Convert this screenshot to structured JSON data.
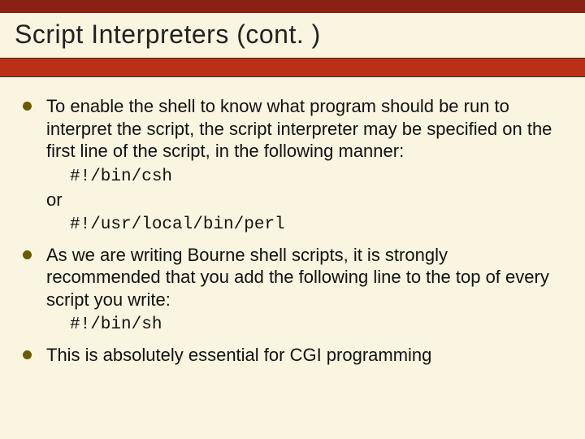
{
  "slide": {
    "title": "Script Interpreters (cont. )",
    "items": [
      {
        "text": "To enable the shell to know what program should be run to interpret the script, the script interpreter may be specified on the first line of the script, in the following manner:",
        "code1": "#!/bin/csh",
        "or": "or",
        "code2": "#!/usr/local/bin/perl"
      },
      {
        "text": "As we are writing Bourne shell scripts, it is strongly recommended that you add the following line to the top of every script you write:",
        "code1": "#!/bin/sh"
      },
      {
        "text": "This is absolutely essential for CGI programming"
      }
    ]
  }
}
